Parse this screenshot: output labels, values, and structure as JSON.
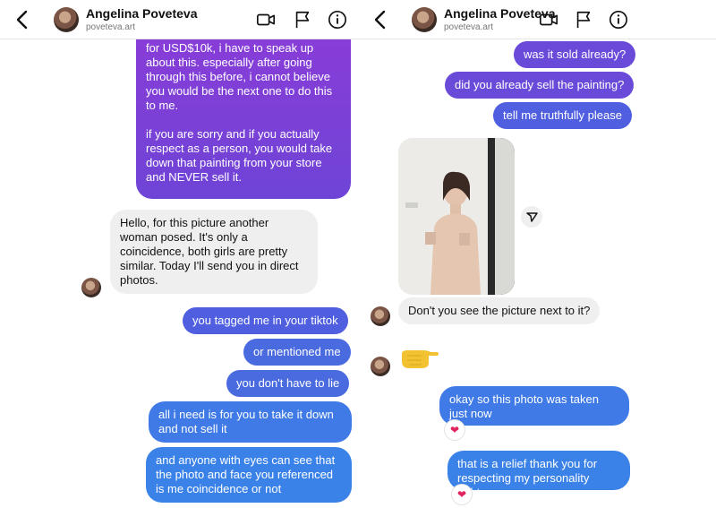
{
  "left": {
    "header": {
      "name": "Angelina Poveteva",
      "handle": "poveteva.art"
    },
    "messages": [
      {
        "text": "for USD$10k, i have to speak up about this. especially after going through this before, i cannot believe you would be the next one to do this to me.\n\nif you are sorry and if you actually respect as a person, you would take down that painting from your store and NEVER sell it."
      },
      {
        "text": "Hello, for this picture another woman posed. It's only a coincidence, both girls are pretty similar. Today I'll send you in direct photos."
      },
      {
        "text": "you tagged me in your tiktok"
      },
      {
        "text": "or mentioned me"
      },
      {
        "text": "you don't have to lie"
      },
      {
        "text": "all i need is for you to take it down and not sell it"
      },
      {
        "text": "and anyone with eyes can see that the photo and face you referenced is me coincidence or not"
      }
    ]
  },
  "right": {
    "header": {
      "name": "Angelina Poveteva",
      "handle": "poveteva.art"
    },
    "messages": [
      {
        "text": "was it sold already?"
      },
      {
        "text": "did you already sell the painting?"
      },
      {
        "text": "tell me truthfully please"
      },
      {
        "text": "Don't you see the picture next to it?"
      },
      {
        "text": "okay so this photo was taken just now",
        "reaction": "heart"
      },
      {
        "text": "that is a relief thank you for respecting my personality rights",
        "reaction": "heart"
      }
    ],
    "emoji_hand": "pointing-right-hand"
  },
  "colors": {
    "purple": "#7a3fd2",
    "blue": "#3b82e8",
    "incoming": "#efefef",
    "heart": "#e0245e"
  },
  "icons": [
    "back-chevron-icon",
    "video-call-icon",
    "flag-icon",
    "info-icon",
    "share-icon",
    "heart-icon"
  ]
}
